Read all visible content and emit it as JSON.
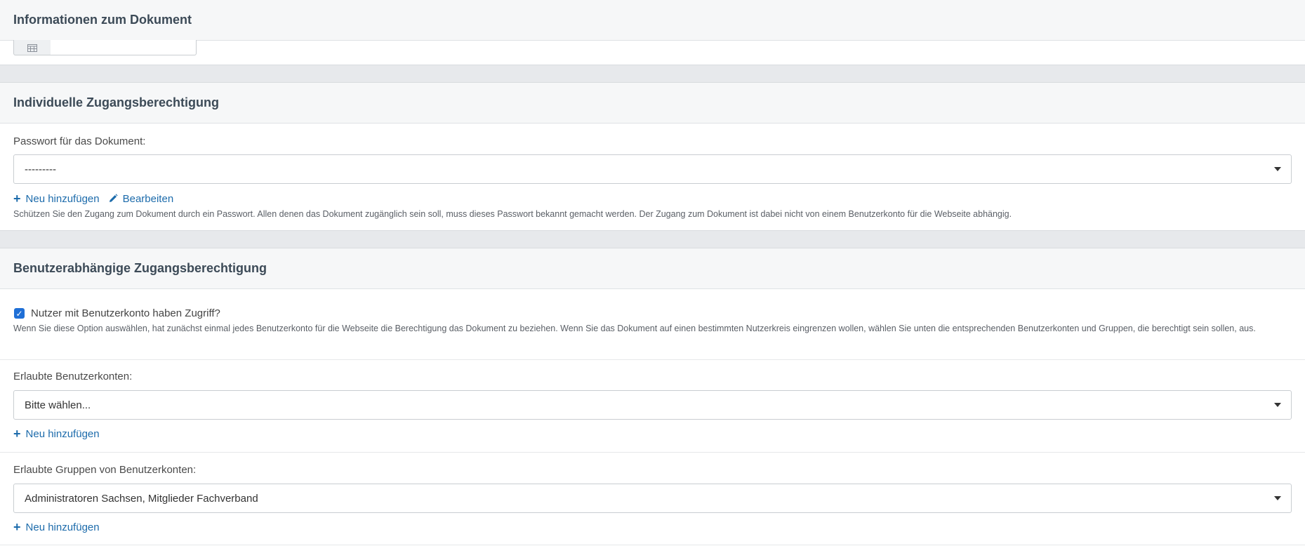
{
  "section_info": {
    "title": "Informationen zum Dokument"
  },
  "section_password": {
    "title": "Individuelle Zugangsberechtigung",
    "label": "Passwort für das Dokument:",
    "select_value": "---------",
    "add_label": "Neu hinzufügen",
    "edit_label": "Bearbeiten",
    "help": "Schützen Sie den Zugang zum Dokument durch ein Passwort. Allen denen das Dokument zugänglich sein soll, muss dieses Passwort bekannt gemacht werden. Der Zugang zum Dokument ist dabei nicht von einem Benutzerkonto für die Webseite abhängig."
  },
  "section_user": {
    "title": "Benutzerabhängige Zugangsberechtigung",
    "checkbox_label": "Nutzer mit Benutzerkonto haben Zugriff?",
    "checkbox_checked": true,
    "checkbox_help": "Wenn Sie diese Option auswählen, hat zunächst einmal jedes Benutzerkonto für die Webseite die Berechtigung das Dokument zu beziehen. Wenn Sie das Dokument auf einen bestimmten Nutzerkreis eingrenzen wollen, wählen Sie unten die entsprechenden Benutzerkonten und Gruppen, die berechtigt sein sollen, aus.",
    "accounts_label": "Erlaubte Benutzerkonten:",
    "accounts_value": "Bitte wählen...",
    "accounts_add_label": "Neu hinzufügen",
    "groups_label": "Erlaubte Gruppen von Benutzerkonten:",
    "groups_value": "Administratoren Sachsen, Mitglieder Fachverband",
    "groups_add_label": "Neu hinzufügen"
  },
  "colors": {
    "link": "#1c6bab",
    "checkbox": "#1f6fd6",
    "heading_bg": "#f6f7f8",
    "gap_bg": "#e7e9ec"
  }
}
